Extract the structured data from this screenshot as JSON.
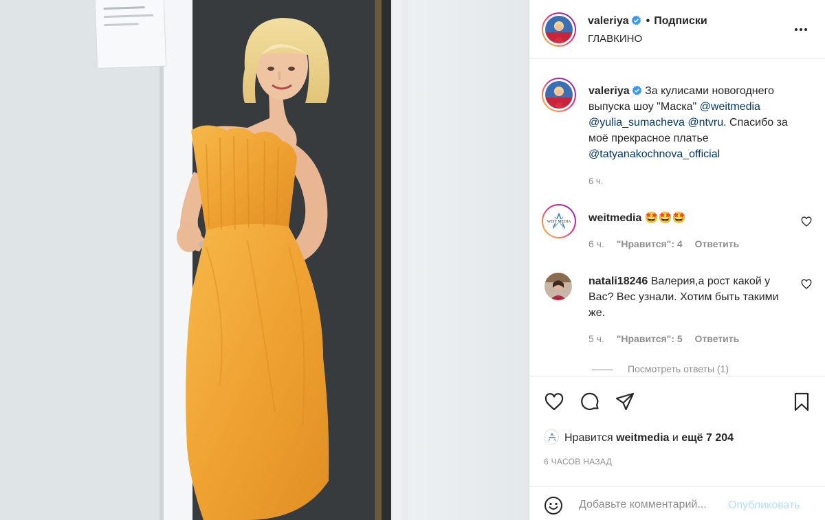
{
  "post": {
    "username": "valeriya",
    "follow_dot": "•",
    "follow_label": "Подписки",
    "location": "ГЛАВКИНО"
  },
  "caption": {
    "username": "valeriya",
    "text_1": "За кулисами новогоднего выпуска шоу \"Маска\" ",
    "mention_1": "@weitmedia",
    "mention_2": "@yulia_sumacheva",
    "mention_3": "@ntvru",
    "text_2": ". Спасибо за моё прекрасное платье ",
    "mention_4": "@tatyanakochnova_official",
    "time": "6 ч."
  },
  "comments": [
    {
      "username": "weitmedia",
      "text": "🤩🤩🤩",
      "time": "6 ч.",
      "likes": "\"Нравится\": 4",
      "reply": "Ответить",
      "avatar_text": "WEIT MEDIA"
    },
    {
      "username": "natali18246",
      "text": "Валерия,а рост какой у Вас? Вес узнали. Хотим быть такими же.",
      "time": "5 ч.",
      "likes": "\"Нравится\": 5",
      "reply": "Ответить"
    }
  ],
  "view_replies": "Посмотреть ответы (1)",
  "likes_line": {
    "prefix": "Нравится",
    "user": "weitmedia",
    "mid": "и",
    "more": "ещё 7 204"
  },
  "posted_ago": "6 ЧАСОВ НАЗАД",
  "add_comment": {
    "placeholder": "Добавьте комментарий...",
    "publish_label": "Опубликовать"
  },
  "icons": {
    "more": "more-horizontal-icon",
    "verified": "verified-badge-icon",
    "like": "heart-icon",
    "comment": "comment-icon",
    "share": "paper-plane-icon",
    "save": "bookmark-icon",
    "emoji": "smiley-icon"
  },
  "colors": {
    "text": "#262626",
    "muted": "#8e8e8e",
    "link": "#00376b",
    "verified": "#3897f0",
    "publish_disabled": "#b2dffc",
    "dress": "#f0a63a"
  }
}
